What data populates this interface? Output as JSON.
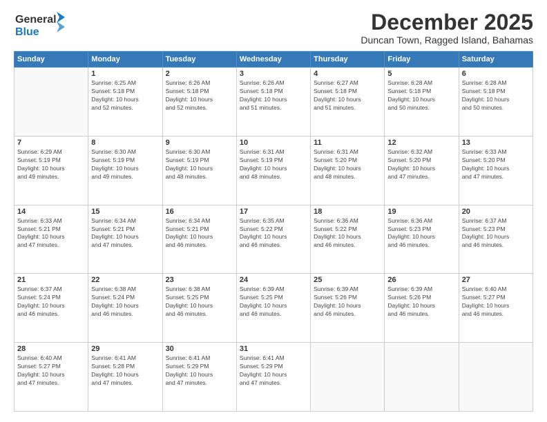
{
  "header": {
    "logo_general": "General",
    "logo_blue": "Blue",
    "month": "December 2025",
    "location": "Duncan Town, Ragged Island, Bahamas"
  },
  "days_of_week": [
    "Sunday",
    "Monday",
    "Tuesday",
    "Wednesday",
    "Thursday",
    "Friday",
    "Saturday"
  ],
  "weeks": [
    [
      {
        "day": "",
        "info": ""
      },
      {
        "day": "1",
        "info": "Sunrise: 6:25 AM\nSunset: 5:18 PM\nDaylight: 10 hours\nand 52 minutes."
      },
      {
        "day": "2",
        "info": "Sunrise: 6:26 AM\nSunset: 5:18 PM\nDaylight: 10 hours\nand 52 minutes."
      },
      {
        "day": "3",
        "info": "Sunrise: 6:26 AM\nSunset: 5:18 PM\nDaylight: 10 hours\nand 51 minutes."
      },
      {
        "day": "4",
        "info": "Sunrise: 6:27 AM\nSunset: 5:18 PM\nDaylight: 10 hours\nand 51 minutes."
      },
      {
        "day": "5",
        "info": "Sunrise: 6:28 AM\nSunset: 5:18 PM\nDaylight: 10 hours\nand 50 minutes."
      },
      {
        "day": "6",
        "info": "Sunrise: 6:28 AM\nSunset: 5:18 PM\nDaylight: 10 hours\nand 50 minutes."
      }
    ],
    [
      {
        "day": "7",
        "info": "Sunrise: 6:29 AM\nSunset: 5:19 PM\nDaylight: 10 hours\nand 49 minutes."
      },
      {
        "day": "8",
        "info": "Sunrise: 6:30 AM\nSunset: 5:19 PM\nDaylight: 10 hours\nand 49 minutes."
      },
      {
        "day": "9",
        "info": "Sunrise: 6:30 AM\nSunset: 5:19 PM\nDaylight: 10 hours\nand 48 minutes."
      },
      {
        "day": "10",
        "info": "Sunrise: 6:31 AM\nSunset: 5:19 PM\nDaylight: 10 hours\nand 48 minutes."
      },
      {
        "day": "11",
        "info": "Sunrise: 6:31 AM\nSunset: 5:20 PM\nDaylight: 10 hours\nand 48 minutes."
      },
      {
        "day": "12",
        "info": "Sunrise: 6:32 AM\nSunset: 5:20 PM\nDaylight: 10 hours\nand 47 minutes."
      },
      {
        "day": "13",
        "info": "Sunrise: 6:33 AM\nSunset: 5:20 PM\nDaylight: 10 hours\nand 47 minutes."
      }
    ],
    [
      {
        "day": "14",
        "info": "Sunrise: 6:33 AM\nSunset: 5:21 PM\nDaylight: 10 hours\nand 47 minutes."
      },
      {
        "day": "15",
        "info": "Sunrise: 6:34 AM\nSunset: 5:21 PM\nDaylight: 10 hours\nand 47 minutes."
      },
      {
        "day": "16",
        "info": "Sunrise: 6:34 AM\nSunset: 5:21 PM\nDaylight: 10 hours\nand 46 minutes."
      },
      {
        "day": "17",
        "info": "Sunrise: 6:35 AM\nSunset: 5:22 PM\nDaylight: 10 hours\nand 46 minutes."
      },
      {
        "day": "18",
        "info": "Sunrise: 6:36 AM\nSunset: 5:22 PM\nDaylight: 10 hours\nand 46 minutes."
      },
      {
        "day": "19",
        "info": "Sunrise: 6:36 AM\nSunset: 5:23 PM\nDaylight: 10 hours\nand 46 minutes."
      },
      {
        "day": "20",
        "info": "Sunrise: 6:37 AM\nSunset: 5:23 PM\nDaylight: 10 hours\nand 46 minutes."
      }
    ],
    [
      {
        "day": "21",
        "info": "Sunrise: 6:37 AM\nSunset: 5:24 PM\nDaylight: 10 hours\nand 46 minutes."
      },
      {
        "day": "22",
        "info": "Sunrise: 6:38 AM\nSunset: 5:24 PM\nDaylight: 10 hours\nand 46 minutes."
      },
      {
        "day": "23",
        "info": "Sunrise: 6:38 AM\nSunset: 5:25 PM\nDaylight: 10 hours\nand 46 minutes."
      },
      {
        "day": "24",
        "info": "Sunrise: 6:39 AM\nSunset: 5:25 PM\nDaylight: 10 hours\nand 46 minutes."
      },
      {
        "day": "25",
        "info": "Sunrise: 6:39 AM\nSunset: 5:26 PM\nDaylight: 10 hours\nand 46 minutes."
      },
      {
        "day": "26",
        "info": "Sunrise: 6:39 AM\nSunset: 5:26 PM\nDaylight: 10 hours\nand 46 minutes."
      },
      {
        "day": "27",
        "info": "Sunrise: 6:40 AM\nSunset: 5:27 PM\nDaylight: 10 hours\nand 46 minutes."
      }
    ],
    [
      {
        "day": "28",
        "info": "Sunrise: 6:40 AM\nSunset: 5:27 PM\nDaylight: 10 hours\nand 47 minutes."
      },
      {
        "day": "29",
        "info": "Sunrise: 6:41 AM\nSunset: 5:28 PM\nDaylight: 10 hours\nand 47 minutes."
      },
      {
        "day": "30",
        "info": "Sunrise: 6:41 AM\nSunset: 5:29 PM\nDaylight: 10 hours\nand 47 minutes."
      },
      {
        "day": "31",
        "info": "Sunrise: 6:41 AM\nSunset: 5:29 PM\nDaylight: 10 hours\nand 47 minutes."
      },
      {
        "day": "",
        "info": ""
      },
      {
        "day": "",
        "info": ""
      },
      {
        "day": "",
        "info": ""
      }
    ]
  ]
}
